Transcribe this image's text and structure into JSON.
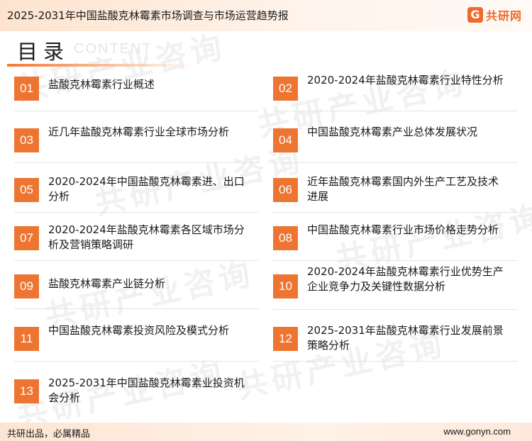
{
  "header": {
    "title": "2025-2031年中国盐酸克林霉素市场调查与市场运营趋势报",
    "logo_mark": "G",
    "logo_text": "共研网"
  },
  "toc": {
    "title": "目录",
    "subtitle": "CONTENT",
    "items": [
      {
        "num": "01",
        "text": "盐酸克林霉素行业概述"
      },
      {
        "num": "02",
        "text": "2020-2024年盐酸克林霉素行业特性分析"
      },
      {
        "num": "03",
        "text": "近几年盐酸克林霉素行业全球市场分析"
      },
      {
        "num": "04",
        "text": "中国盐酸克林霉素产业总体发展状况"
      },
      {
        "num": "05",
        "text": "2020-2024年中国盐酸克林霉素进、出口分析"
      },
      {
        "num": "06",
        "text": "近年盐酸克林霉素国内外生产工艺及技术进展"
      },
      {
        "num": "07",
        "text": "2020-2024年盐酸克林霉素各区域市场分析及营销策略调研"
      },
      {
        "num": "08",
        "text": "中国盐酸克林霉素行业市场价格走势分析"
      },
      {
        "num": "09",
        "text": "盐酸克林霉素产业链分析"
      },
      {
        "num": "10",
        "text": "2020-2024年盐酸克林霉素行业优势生产企业竞争力及关键性数据分析"
      },
      {
        "num": "11",
        "text": "中国盐酸克林霉素投资风险及模式分析"
      },
      {
        "num": "12",
        "text": "2025-2031年盐酸克林霉素行业发展前景策略分析"
      },
      {
        "num": "13",
        "text": "2025-2031年中国盐酸克林霉素业投资机会分析"
      }
    ]
  },
  "watermark": {
    "text": "共研产业咨询",
    "url": "www.gonyn.com"
  },
  "footer": {
    "slogan": "共研出品，必属精品",
    "website": "www.gonyn.com"
  },
  "colors": {
    "accent": "#ee7431"
  }
}
